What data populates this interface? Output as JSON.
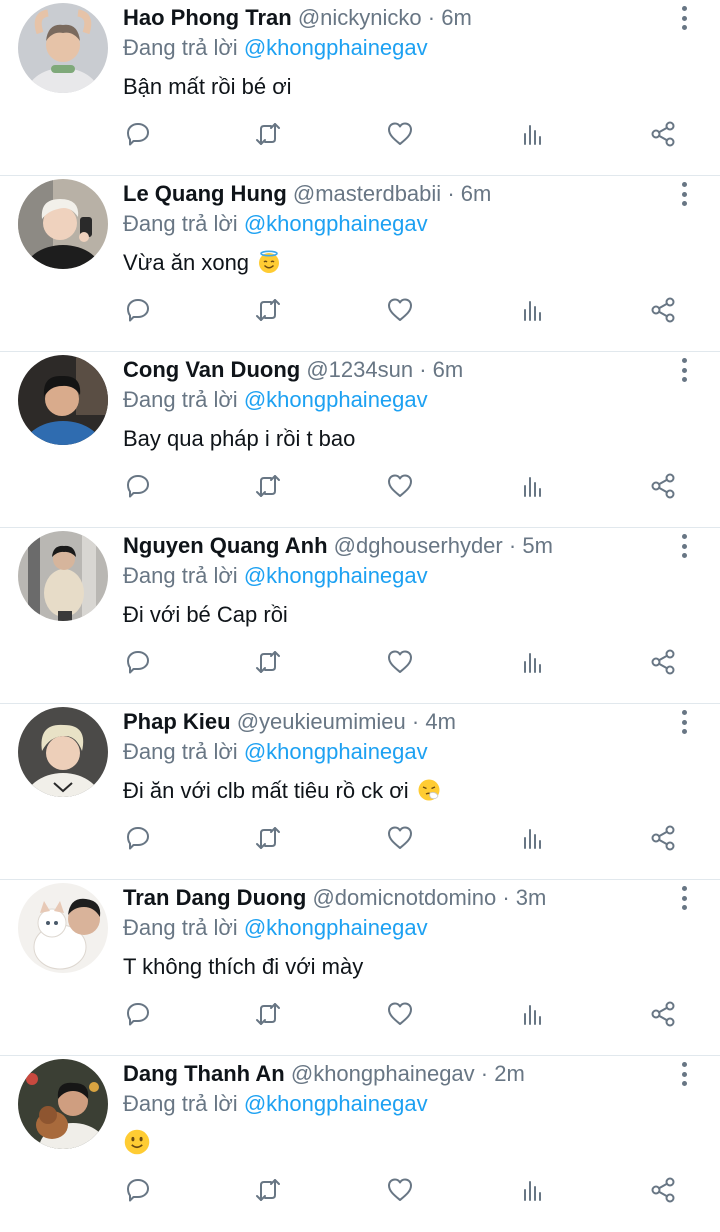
{
  "reply_prefix": "Đang trả lời",
  "tweets": [
    {
      "name": "Hao Phong Tran",
      "handle": "@nickynicko",
      "separator": "·",
      "time": "6m",
      "reply_to": "@khongphainegav",
      "text": "Bận mất rồi bé ơi",
      "emoji": ""
    },
    {
      "name": "Le Quang Hung",
      "handle": "@masterdbabii",
      "separator": "·",
      "time": "6m",
      "reply_to": "@khongphainegav",
      "text": "Vừa ăn xong",
      "emoji": "smiling-face-with-halo"
    },
    {
      "name": "Cong Van Duong",
      "handle": "@1234sun",
      "separator": "·",
      "time": "6m",
      "reply_to": "@khongphainegav",
      "text": "Bay qua pháp i rồi t bao",
      "emoji": ""
    },
    {
      "name": "Nguyen Quang Anh",
      "handle": "@dghouserhyder",
      "separator": "·",
      "time": "5m",
      "reply_to": "@khongphainegav",
      "text": "Đi với bé Cap rồi",
      "emoji": ""
    },
    {
      "name": "Phap Kieu",
      "handle": "@yeukieumimieu",
      "separator": "·",
      "time": "4m",
      "reply_to": "@khongphainegav",
      "text": "Đi ăn với clb mất tiêu rồ ck ơi",
      "emoji": "sneezing-face"
    },
    {
      "name": "Tran Dang Duong",
      "handle": "@domicnotdomino",
      "separator": "·",
      "time": "3m",
      "reply_to": "@khongphainegav",
      "text": "T không thích đi với mày",
      "emoji": ""
    },
    {
      "name": "Dang Thanh An",
      "handle": "@khongphainegav",
      "separator": "·",
      "time": "2m",
      "reply_to": "@khongphainegav",
      "text": "",
      "emoji": "slightly-smiling-face"
    }
  ],
  "icons": {
    "reply": "reply-icon",
    "retweet": "retweet-icon",
    "like": "like-icon",
    "stats": "stats-icon",
    "share": "share-icon",
    "more": "more-vertical-icon"
  },
  "colors": {
    "name": "#0f1419",
    "muted": "#687684",
    "mention": "#1da1f2",
    "divider": "#e1e8ed"
  }
}
